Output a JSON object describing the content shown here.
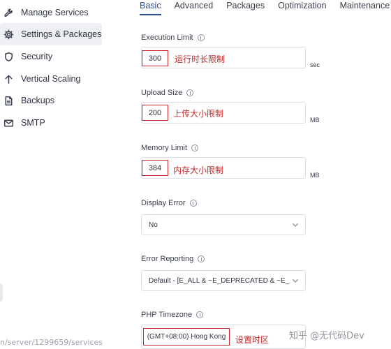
{
  "sidebar": {
    "items": [
      {
        "label": "Manage Services",
        "icon": "wrench-icon"
      },
      {
        "label": "Settings & Packages",
        "icon": "gear-icon"
      },
      {
        "label": "Security",
        "icon": "shield-icon"
      },
      {
        "label": "Vertical Scaling",
        "icon": "arrow-up-icon"
      },
      {
        "label": "Backups",
        "icon": "file-icon"
      },
      {
        "label": "SMTP",
        "icon": "mail-icon"
      }
    ],
    "active_index": 1
  },
  "tabs": [
    {
      "label": "Basic",
      "active": true
    },
    {
      "label": "Advanced",
      "active": false
    },
    {
      "label": "Packages",
      "active": false
    },
    {
      "label": "Optimization",
      "active": false
    },
    {
      "label": "Maintenance",
      "active": false
    }
  ],
  "form": {
    "execution_limit": {
      "label": "Execution Limit",
      "value": "300",
      "unit": "sec",
      "annotation": "运行时长限制"
    },
    "upload_size": {
      "label": "Upload Size",
      "value": "200",
      "unit": "MB",
      "annotation": "上传大小限制"
    },
    "memory_limit": {
      "label": "Memory Limit",
      "value": "384",
      "unit": "MB",
      "annotation": "内存大小限制"
    },
    "display_error": {
      "label": "Display Error",
      "value": "No"
    },
    "error_reporting": {
      "label": "Error Reporting",
      "value": "Default - [E_ALL & ~E_DEPRECATED & ~E_STR"
    },
    "php_timezone": {
      "label": "PHP Timezone",
      "value": "(GMT+08:00) Hong Kong",
      "annotation": "设置时区"
    }
  },
  "url_text": "n/server/1299659/services",
  "watermark": "知乎 @无代码Dev",
  "colors": {
    "accent": "#2b4a8c",
    "annotation_red": "#c62a2a",
    "active_bg": "#eef0f4"
  }
}
